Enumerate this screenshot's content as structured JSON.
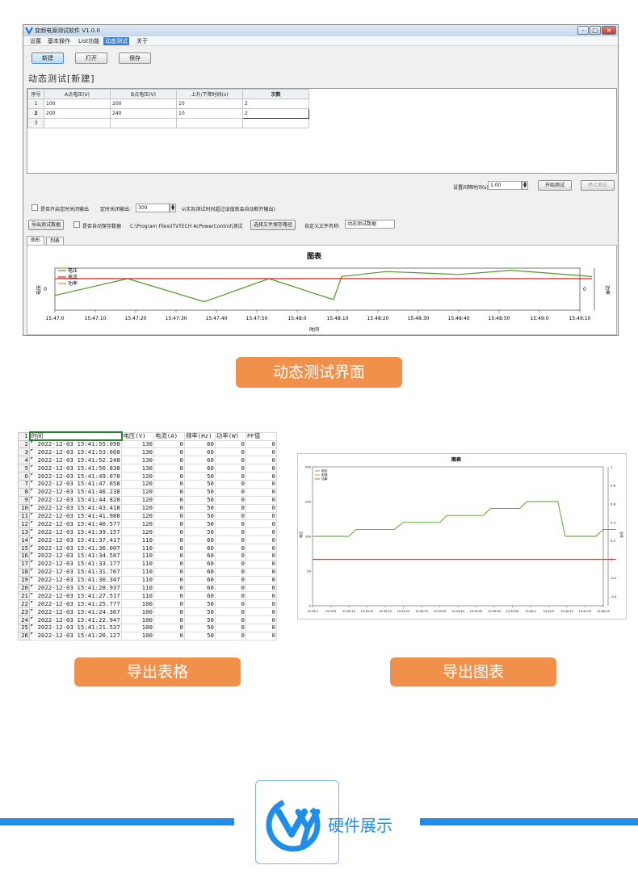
{
  "app": {
    "title": "变频电源测试软件 V1.0.0",
    "menu": [
      "设置",
      "基本操作",
      "List功能",
      "动态测试",
      "关于"
    ],
    "active_menu_index": 3,
    "toolbar": {
      "new": "新建",
      "open": "打开",
      "save": "保存"
    },
    "page_title": "动态测试[新建]",
    "grid": {
      "headers": [
        "序号",
        "A点电压(V)",
        "B点电压(V)",
        "上升/下降时间(s)",
        "次数"
      ],
      "rows": [
        {
          "no": "1",
          "a": "100",
          "b": "200",
          "t": "10",
          "n": "2"
        },
        {
          "no": "2",
          "a": "200",
          "b": "240",
          "t": "10",
          "n": "2"
        },
        {
          "no": "3",
          "a": "",
          "b": "",
          "t": "",
          "n": ""
        }
      ]
    },
    "controls": {
      "interval_label": "设置间隔时间(s):",
      "interval_value": "1.00",
      "start": "开始测试",
      "stop": "停止测试",
      "timed_off_label": "是否开启定时关闭输出",
      "timed_off_value_label": "定时关闭输出:",
      "timed_off_value": "300",
      "timed_off_hint": "s(实际测试时间超过该值就会自动断开输出)",
      "export_data": "导出测试数据",
      "auto_save_label": "是否自动保存数据",
      "save_path": "C:\\Program Files\\ITVTECH AcPowerControl\\测试",
      "choose_path": "选择文件保存路径",
      "custom_name_label": "自定义文件名称:",
      "custom_name_value": "动态测试数据"
    },
    "tabs": [
      "图形",
      "列表"
    ],
    "chart": {
      "title": "图表",
      "y_left": "电压",
      "y_right": "功率",
      "x_label": "时间",
      "legend": [
        "电压",
        "电流",
        "功率"
      ],
      "left_tick": "0",
      "right_tick": "0"
    }
  },
  "chart_data": [
    {
      "type": "line",
      "title": "图表",
      "xlabel": "时间",
      "ylabel": "电压",
      "y2label": "功率",
      "categories": [
        "15:47:0",
        "15:47:10",
        "15:47:20",
        "15:47:30",
        "15:47:40",
        "15:47:50",
        "15:48:0",
        "15:48:10",
        "15:48:20",
        "15:48:30",
        "15:48:40",
        "15:48:50",
        "15:49:0",
        "15:49:10"
      ],
      "series": [
        {
          "name": "电压",
          "color": "#4d9a1f",
          "points": [
            [
              0,
              0.35
            ],
            [
              1.8,
              0.75
            ],
            [
              3.7,
              0.2
            ],
            [
              5.3,
              0.75
            ],
            [
              6.9,
              0.25
            ],
            [
              7.1,
              0.8
            ],
            [
              8.2,
              0.92
            ],
            [
              10,
              0.85
            ],
            [
              11.3,
              0.95
            ],
            [
              13.3,
              0.8
            ]
          ]
        },
        {
          "name": "电流",
          "color": "#d62020",
          "points": [
            [
              0,
              0.75
            ],
            [
              13.3,
              0.75
            ]
          ]
        },
        {
          "name": "功率",
          "color": "#d98c1a",
          "points": []
        }
      ],
      "legend": "top-left"
    },
    {
      "type": "line",
      "title": "图表",
      "ylabel": "电压",
      "y2label": "功率",
      "categories": [
        "15:39:0",
        "15:39:5",
        "15:39:10",
        "15:39:15",
        "15:39:20",
        "15:39:25",
        "15:39:30",
        "15:39:35",
        "15:39:40",
        "15:39:45",
        "15:39:50",
        "15:39:55",
        "15:40:0",
        "15:40:5",
        "15:40:10",
        "15:40:15",
        "15:40:20"
      ],
      "y_ticks_left": [
        "0",
        "50",
        "100",
        "150",
        "200"
      ],
      "y_ticks_right": [
        "-0.4",
        "-0.2",
        "0",
        "0.2",
        "0.4",
        "0.6",
        "0.8",
        "1"
      ],
      "ylim": [
        0,
        200
      ],
      "y2lim": [
        -0.5,
        1
      ],
      "series": [
        {
          "name": "电压",
          "color": "#4d9a1f",
          "points": [
            [
              0,
              100
            ],
            [
              2,
              100
            ],
            [
              2.4,
              110
            ],
            [
              4.5,
              110
            ],
            [
              5,
              120
            ],
            [
              7,
              120
            ],
            [
              7.4,
              130
            ],
            [
              9.4,
              130
            ],
            [
              9.8,
              140
            ],
            [
              11.4,
              140
            ],
            [
              11.8,
              150
            ],
            [
              13.5,
              150
            ],
            [
              13.9,
              100
            ],
            [
              15.6,
              100
            ],
            [
              16,
              110
            ],
            [
              16.7,
              110
            ]
          ]
        },
        {
          "name": "电流",
          "color": "#e07020",
          "points": []
        },
        {
          "name": "功率",
          "color": "#d62020",
          "points": [
            [
              0,
              67
            ],
            [
              16.7,
              67
            ]
          ]
        }
      ],
      "legend": "top-left"
    }
  ],
  "captions": {
    "dynamic": "动态测试界面",
    "export_table": "导出表格",
    "export_chart": "导出图表",
    "hardware": "硬件展示"
  },
  "excel": {
    "headers": [
      "时间",
      "电压(V)",
      "电流(A)",
      "频率(Hz)",
      "功率(W)",
      "PF值"
    ],
    "rows": [
      [
        "2022-12-03 15:41:55.098",
        "130",
        "0",
        "60",
        "0",
        "0"
      ],
      [
        "2022-12-03 15:41:53.668",
        "130",
        "0",
        "60",
        "0",
        "0"
      ],
      [
        "2022-12-03 15:41:52.248",
        "130",
        "0",
        "60",
        "0",
        "0"
      ],
      [
        "2022-12-03 15:41:50.838",
        "130",
        "0",
        "60",
        "0",
        "0"
      ],
      [
        "2022-12-03 15:41:49.078",
        "120",
        "0",
        "50",
        "0",
        "0"
      ],
      [
        "2022-12-03 15:41:47.658",
        "120",
        "0",
        "50",
        "0",
        "0"
      ],
      [
        "2022-12-03 15:41:46.238",
        "120",
        "0",
        "50",
        "0",
        "0"
      ],
      [
        "2022-12-03 15:41:44.828",
        "120",
        "0",
        "50",
        "0",
        "0"
      ],
      [
        "2022-12-03 15:41:43.418",
        "120",
        "0",
        "50",
        "0",
        "0"
      ],
      [
        "2022-12-03 15:41:41.988",
        "120",
        "0",
        "50",
        "0",
        "0"
      ],
      [
        "2022-12-03 15:41:40.577",
        "120",
        "0",
        "50",
        "0",
        "0"
      ],
      [
        "2022-12-03 15:41:39.157",
        "120",
        "0",
        "50",
        "0",
        "0"
      ],
      [
        "2022-12-03 15:41:37.417",
        "110",
        "0",
        "60",
        "0",
        "0"
      ],
      [
        "2022-12-03 15:41:36.007",
        "110",
        "0",
        "60",
        "0",
        "0"
      ],
      [
        "2022-12-03 15:41:34.587",
        "110",
        "0",
        "60",
        "0",
        "0"
      ],
      [
        "2022-12-03 15:41:33.177",
        "110",
        "0",
        "60",
        "0",
        "0"
      ],
      [
        "2022-12-03 15:41:31.767",
        "110",
        "0",
        "60",
        "0",
        "0"
      ],
      [
        "2022-12-03 15:41:30.347",
        "110",
        "0",
        "60",
        "0",
        "0"
      ],
      [
        "2022-12-03 15:41:28.937",
        "110",
        "0",
        "60",
        "0",
        "0"
      ],
      [
        "2022-12-03 15:41:27.517",
        "110",
        "0",
        "60",
        "0",
        "0"
      ],
      [
        "2022-12-03 15:41:25.777",
        "100",
        "0",
        "50",
        "0",
        "0"
      ],
      [
        "2022-12-03 15:41:24.367",
        "100",
        "0",
        "50",
        "0",
        "0"
      ],
      [
        "2022-12-03 15:41:22.947",
        "100",
        "0",
        "50",
        "0",
        "0"
      ],
      [
        "2022-12-03 15:41:21.537",
        "100",
        "0",
        "50",
        "0",
        "0"
      ],
      [
        "2022-12-03 15:41:20.127",
        "100",
        "0",
        "50",
        "0",
        "0"
      ]
    ]
  },
  "colors": {
    "banner": "#f0904a",
    "brand_blue": "#1e8ee8",
    "accent_menu": "#3c7fd4"
  }
}
